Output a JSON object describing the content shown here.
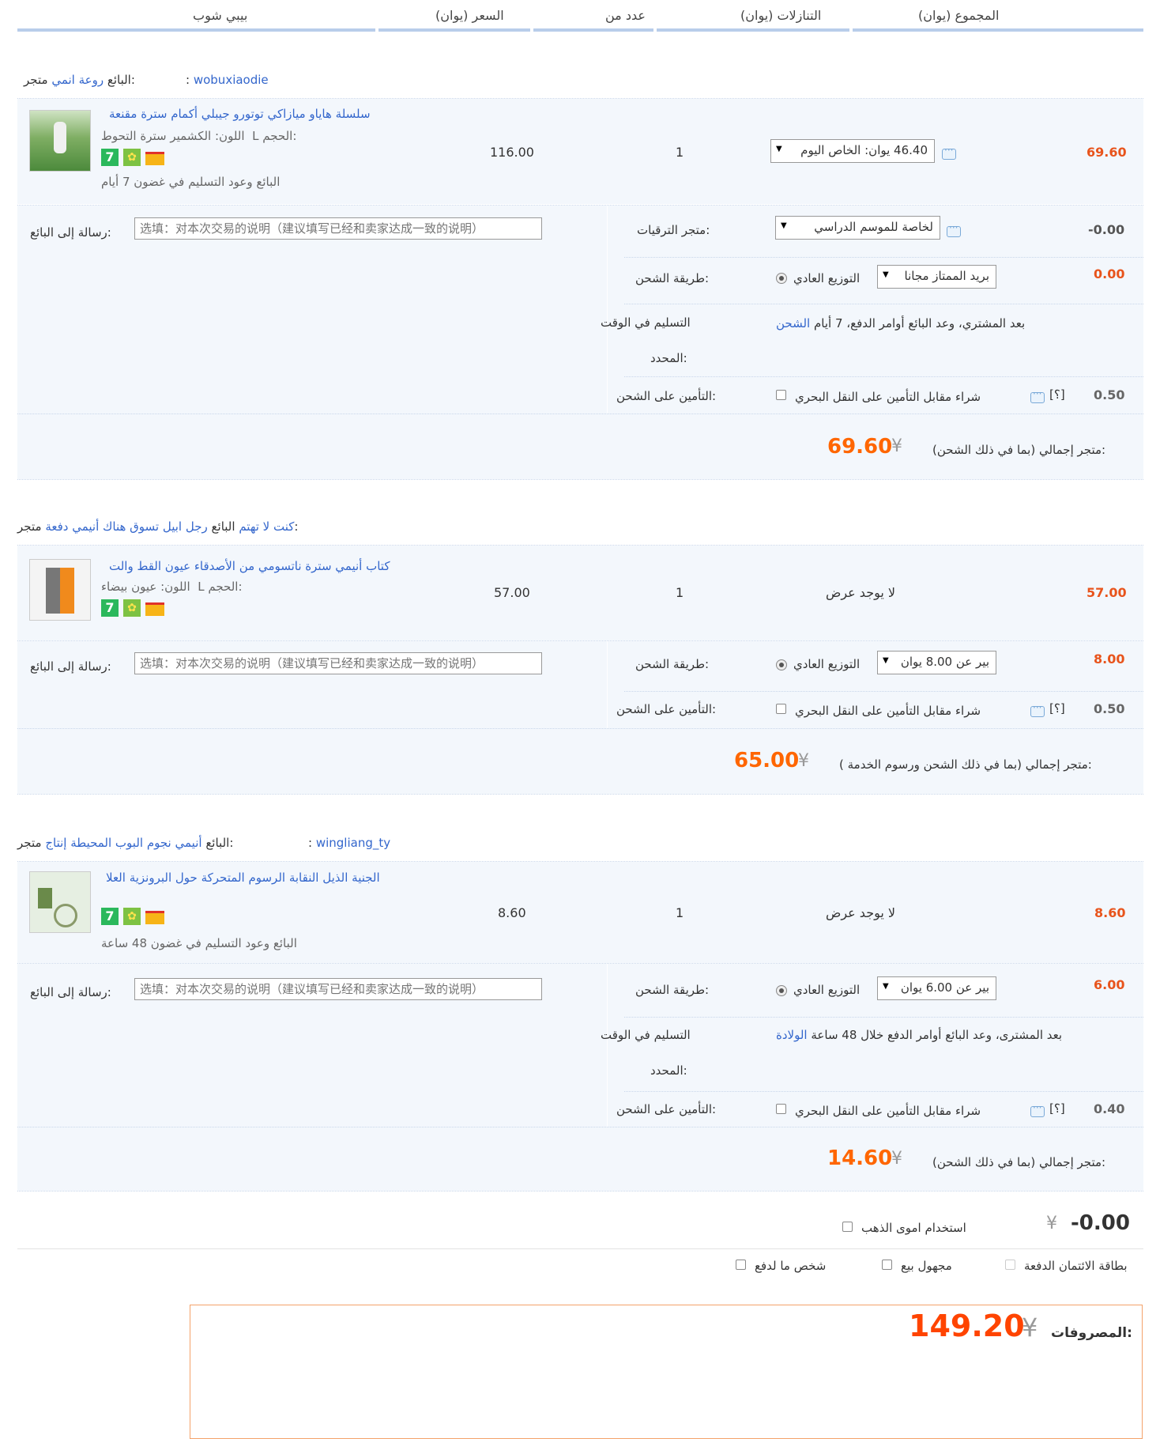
{
  "header": {
    "col_shop": "بيبي شوب",
    "col_price": "(السعر (يوان",
    "col_qty": "عدد من",
    "col_discount": "(التنازلات (يوان",
    "col_total": "(المجموع (يوان"
  },
  "labels": {
    "store": "متجر:",
    "seller": "البائع",
    "message_to_seller": "رسالة إلى البائع:",
    "message_placeholder": "选填：对本次交易的说明（建议填写已经和卖家达成一致的说明）",
    "promo_store": "متجر الترقيات:",
    "shipping_method": "طريقة الشحن:",
    "on_time_delivery_1": "التسليم في الوقت",
    "on_time_delivery_2": "المحدد:",
    "insurance": "التأمين على الشحن:",
    "insurance_option": "شراء مقابل التأمين على النقل البحري",
    "help_mark": "[؟]",
    "normal_delivery": "التوزيع العادي",
    "no_offer": "لا يوجد عرض",
    "color": "اللون:",
    "size": "الحجم:"
  },
  "stores": [
    {
      "seller_name": "wobuxiaodie",
      "store_name": "روعة انمي",
      "item": {
        "title": "سلسلة هاياو ميازاكي توتورو جيبلي أكمام سترة مقنعة",
        "color": "الكشمير سترة التحوط",
        "size": "L",
        "delivery_note": "البائع وعود التسليم في غضون 7 أيام",
        "price": "116.00",
        "qty": "1",
        "discount_select": "46.40 يوان: الخاص اليوم",
        "total": "69.60"
      },
      "promo_select": "لخاصة للموسم الدراسي",
      "promo_value": "-0.00",
      "shipping_select": "بريد الممتاز مجانا",
      "shipping_value": "0.00",
      "on_time_text": "بعد المشتري، وعد البائع أوامر الدفع، 7 أيام",
      "on_time_link": "الشحن",
      "insurance_value": "0.50",
      "subtotal_label": "متجر إجمالي (بما في ذلك الشحن):",
      "subtotal": "69.60"
    },
    {
      "seller_name": "كنت لا تهتم",
      "store_name": "رجل ابيل تسوق هناك أنيمي دفعة",
      "item": {
        "title": "كتاب أنيمي سترة ناتسومي من الأصدقاء عيون القط والت",
        "color": "عيون بيضاء",
        "size": "L",
        "price": "57.00",
        "qty": "1",
        "discount_text": "لا يوجد عرض",
        "total": "57.00"
      },
      "shipping_select": "بير عن 8.00 يوان",
      "shipping_value": "8.00",
      "insurance_value": "0.50",
      "subtotal_label": "متجر إجمالي (بما في ذلك الشحن ورسوم الخدمة ):",
      "subtotal": "65.00"
    },
    {
      "seller_name": "wingliang_ty",
      "store_name": "أنيمي نجوم البوب المحيطة إنتاج",
      "item": {
        "title": "الجنية الذيل النقابة الرسوم المتحركة حول البرونزية العلا",
        "delivery_note": "البائع وعود التسليم في غضون 48 ساعة",
        "price": "8.60",
        "qty": "1",
        "discount_text": "لا يوجد عرض",
        "total": "8.60"
      },
      "shipping_select": "بير عن 6.00 يوان",
      "shipping_value": "6.00",
      "on_time_text": "بعد المشترى، وعد البائع أوامر الدفع خلال 48 ساعة",
      "on_time_link": "الولادة",
      "insurance_value": "0.40",
      "subtotal_label": "متجر إجمالي (بما في ذلك الشحن):",
      "subtotal": "14.60"
    }
  ],
  "gold": {
    "label": "استخدام اموى الذهب",
    "yen": "¥",
    "value": "-0.00"
  },
  "options": {
    "credit_card": "بطاقة الائتمان الدفعة",
    "anonymous": "مجهول بيع",
    "pay_for_me": "شخص ما لدفع"
  },
  "summary": {
    "label": "المصروفات:",
    "yen": "¥",
    "value": "149.20"
  },
  "yen": "¥",
  "colors": {
    "accent": "#ff6600",
    "link": "#3366cc",
    "row_bg": "#f3f7fc"
  }
}
